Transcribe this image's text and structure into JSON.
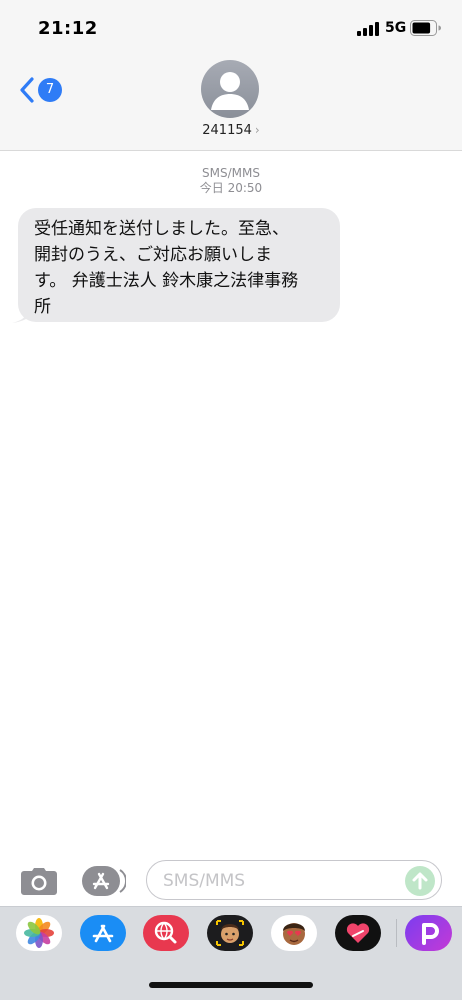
{
  "status_bar": {
    "time": "21:12",
    "network": "5G",
    "signal_bars": 4,
    "battery_level": 0.8
  },
  "header": {
    "back_badge_count": "7",
    "contact_name": "241154",
    "contact_chevron": "›"
  },
  "conversation": {
    "service_label": "SMS/MMS",
    "timestamp": "今日 20:50",
    "messages": [
      {
        "direction": "incoming",
        "lines": [
          "受任通知を送付しました。至急、",
          "開封のうえ、ご対応お願いしま",
          "す。 弁護士法人 鈴木康之法律事務",
          "所"
        ]
      }
    ]
  },
  "composer": {
    "placeholder": "SMS/MMS",
    "value": ""
  },
  "icons": {
    "back": "chevron-left-icon",
    "camera": "camera-icon",
    "apps": "app-store-icon",
    "send": "arrow-up-icon",
    "avatar": "person-icon"
  },
  "app_strip": [
    {
      "name": "photos-app",
      "icon": "photos-icon"
    },
    {
      "name": "app-store-app",
      "icon": "app-store-icon"
    },
    {
      "name": "image-search-app",
      "icon": "globe-search-icon"
    },
    {
      "name": "memoji-app",
      "icon": "memoji-icon"
    },
    {
      "name": "animoji-stickers-app",
      "icon": "sticker-icon"
    },
    {
      "name": "digital-touch-app",
      "icon": "heart-icon"
    },
    {
      "name": "p-app",
      "icon": "p-letter-icon"
    }
  ],
  "colors": {
    "accent": "#2f7cf6",
    "bubble_incoming": "#e9e9eb",
    "send_disabled": "#bfe6c8",
    "app_strip": "#d9dce0"
  }
}
